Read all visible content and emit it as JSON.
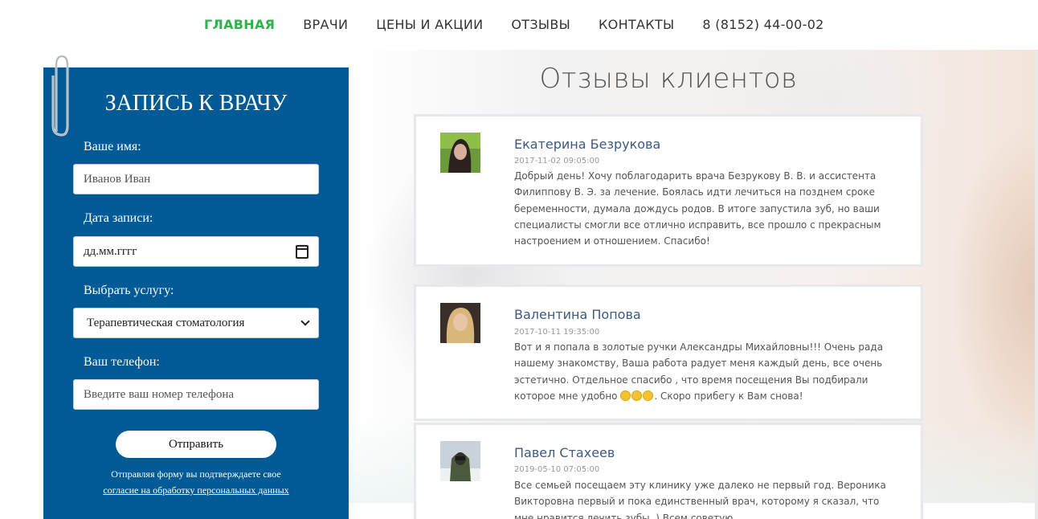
{
  "nav": {
    "items": [
      "ГЛАВНАЯ",
      "ВРАЧИ",
      "ЦЕНЫ И АКЦИИ",
      "ОТЗЫВЫ",
      "КОНТАКТЫ"
    ],
    "phone": "8 (8152) 44-00-02",
    "active_color": "#2fb24a"
  },
  "form": {
    "title": "ЗАПИСЬ К ВРАЧУ",
    "name_label": "Ваше имя:",
    "name_placeholder": "Иванов Иван",
    "date_label": "Дата записи:",
    "date_placeholder": "дд.мм.гггг",
    "service_label": "Выбрать услугу:",
    "service_selected": "Терапевтическая стоматология",
    "phone_label": "Ваш телефон:",
    "phone_placeholder": "Введите ваш номер телефона",
    "submit_label": "Отправить",
    "consent_text": "Отправляя форму вы подтверждаете свое",
    "consent_link": "согласие на обработку персональных данных",
    "panel_color": "#005a95"
  },
  "reviews": {
    "title": "Отзывы клиентов",
    "items": [
      {
        "name": "Екатерина Безрукова",
        "date": "2017-11-02 09:05:00",
        "text": "Добрый день! Хочу поблагодарить врача Безрукову В. В. и ассистента Филиппову В. Э. за лечение. Боялась идти лечиться на позднем сроке беременности, думала дождусь родов. В итоге запустила зуб, но ваши специалисты смогли все отлично исправить, все прошло с прекрасным настроением и отношением. Спасибо!"
      },
      {
        "name": "Валентина Попова",
        "date": "2017-10-11 19:35:00",
        "text_before": "Вот и я попала в золотые ручки Александры Михайловны!!! Очень рада нашему знакомству, Ваша работа радует меня каждый день, все очень эстетично. Отдельное спасибо , что время посещения Вы подбирали которое мне удобно ",
        "text_after": ". Скоро прибегу к Вам снова!"
      },
      {
        "name": "Павел Стахеев",
        "date": "2019-05-10 07:05:00",
        "text": "Все семьей посещаем эту клинику уже далеко не первый год. Вероника Викторовна первый и пока единственный врач, которому я сказал, что мне нравится лечить зубы. ) Всем советую"
      }
    ]
  }
}
